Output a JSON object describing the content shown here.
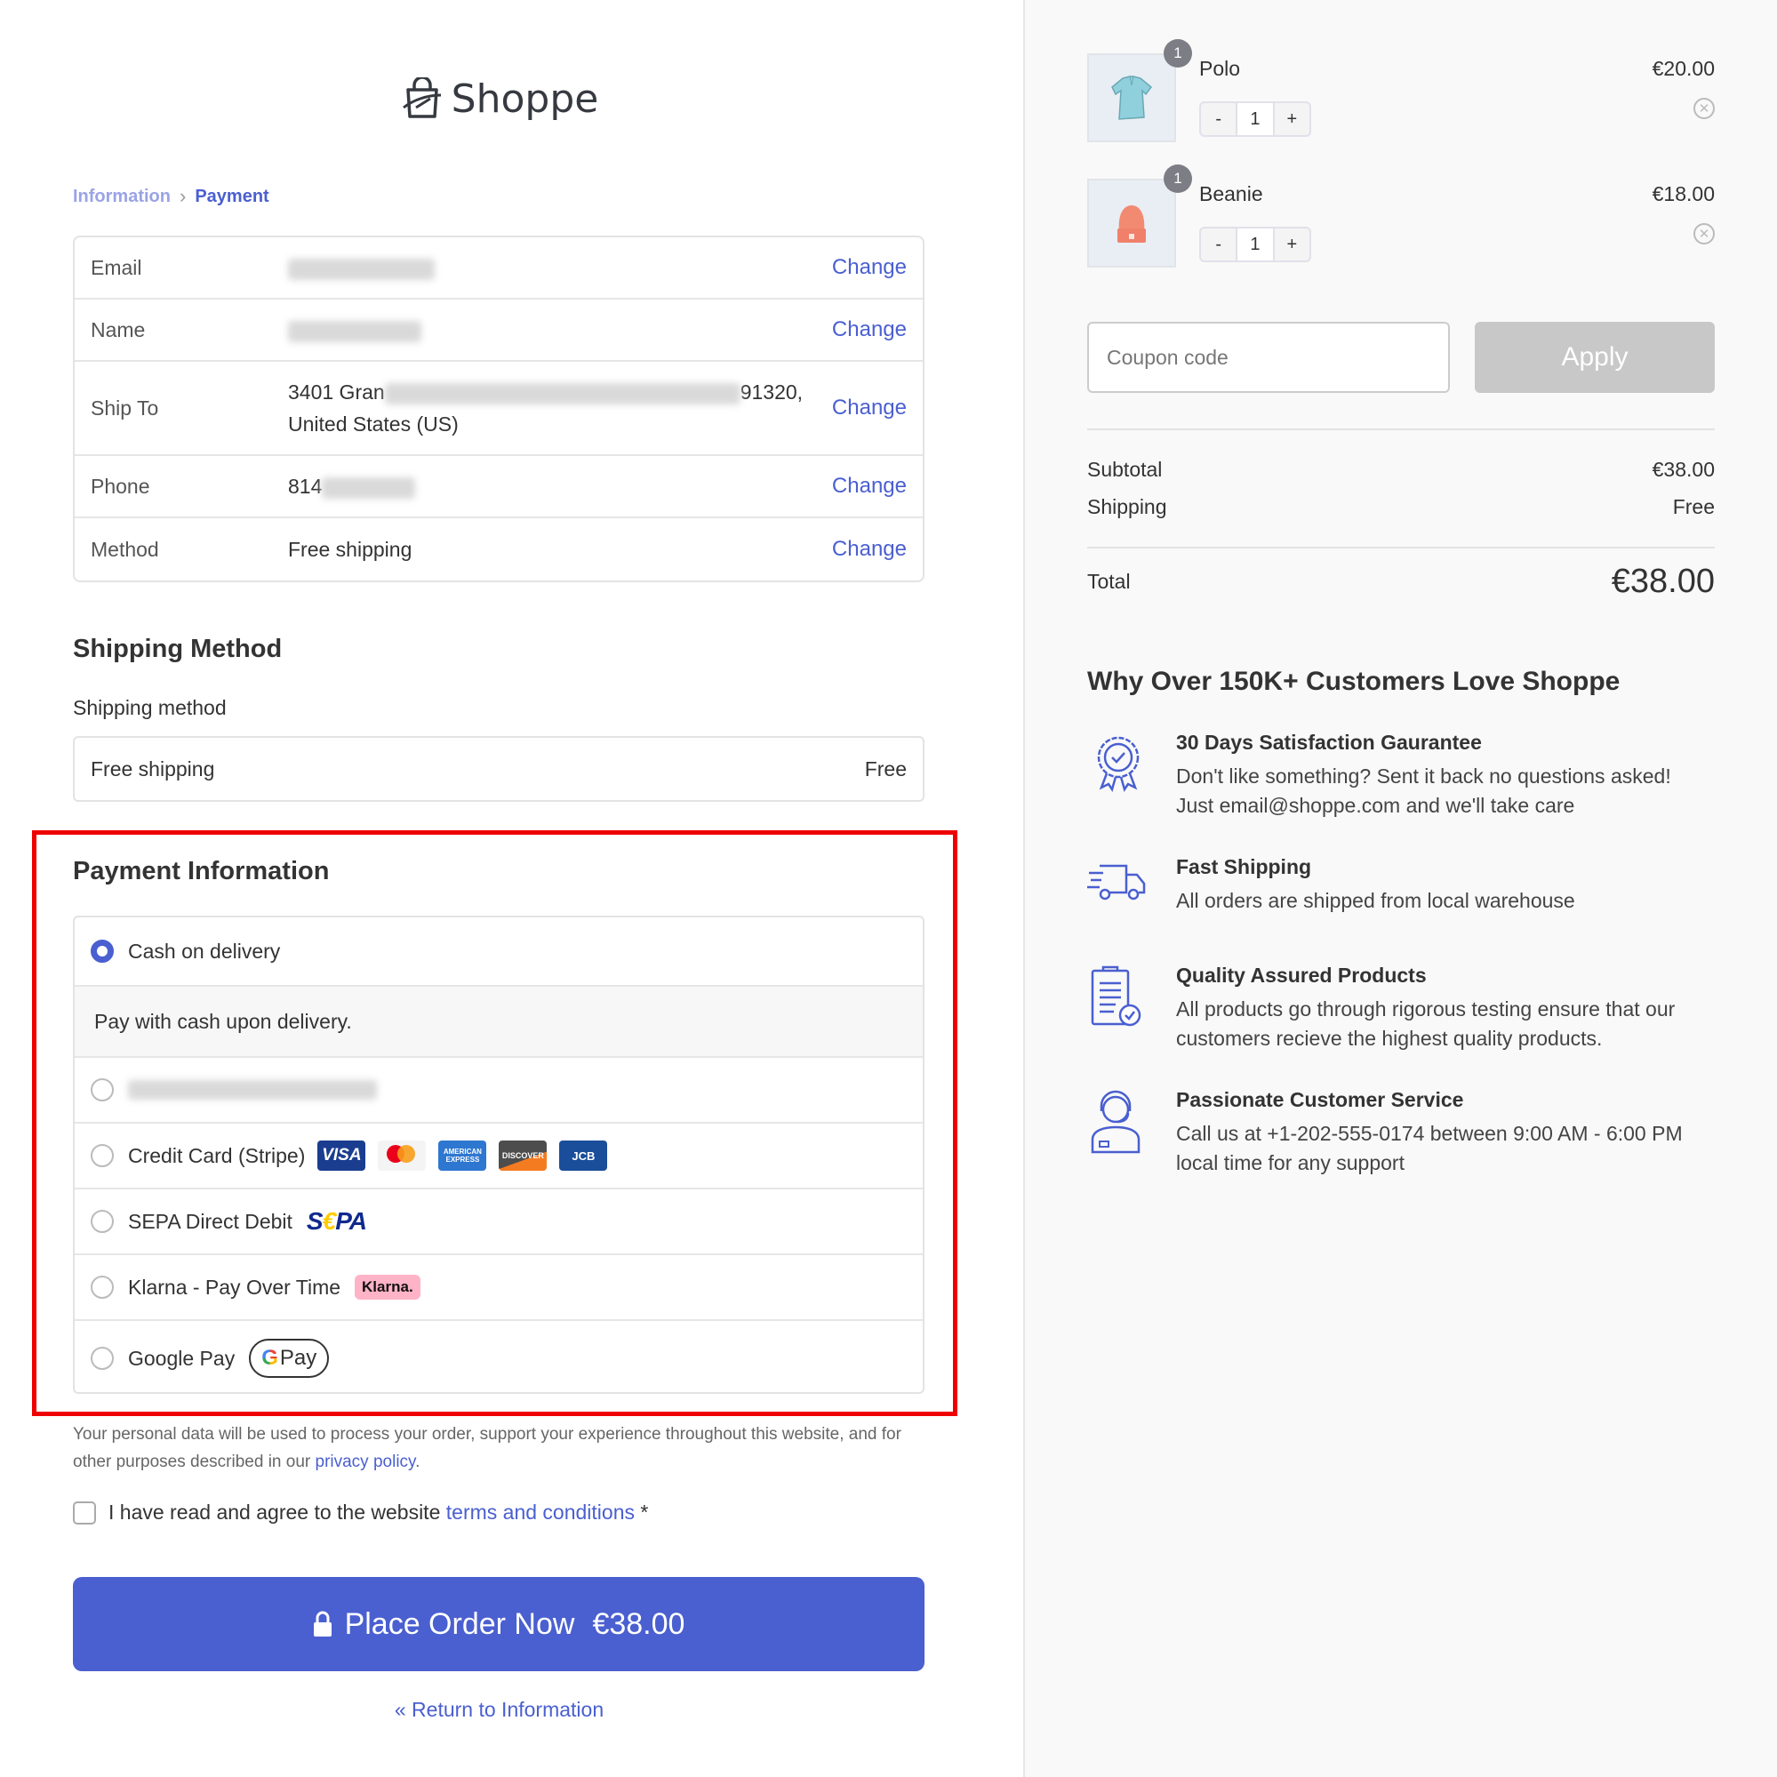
{
  "brand": {
    "name": "Shoppe"
  },
  "breadcrumb": {
    "items": [
      "Information",
      "Payment"
    ]
  },
  "info_table": {
    "change_label": "Change",
    "rows": [
      {
        "label": "Email",
        "value": ""
      },
      {
        "label": "Name",
        "value": ""
      },
      {
        "label": "Ship To",
        "value_line1_start": "3401 Gran",
        "value_line1_end": "91320,",
        "value_line2": "United States (US)"
      },
      {
        "label": "Phone",
        "value": "814"
      },
      {
        "label": "Method",
        "value": "Free shipping"
      }
    ]
  },
  "shipping_method": {
    "heading": "Shipping Method",
    "label": "Shipping method",
    "option_name": "Free shipping",
    "option_price": "Free"
  },
  "payment": {
    "heading": "Payment Information",
    "options": [
      {
        "label": "Cash on delivery",
        "selected": true,
        "description": "Pay with cash upon delivery."
      },
      {
        "label": "",
        "selected": false
      },
      {
        "label": "Credit Card (Stripe)",
        "selected": false,
        "cards": [
          "VISA",
          "mastercard",
          "AMERICAN EXPRESS",
          "DISCOVER",
          "JCB"
        ]
      },
      {
        "label": "SEPA Direct Debit",
        "selected": false,
        "badge": "SEPA"
      },
      {
        "label": "Klarna - Pay Over Time",
        "selected": false,
        "badge": "Klarna."
      },
      {
        "label": "Google Pay",
        "selected": false,
        "badge": "Pay"
      }
    ]
  },
  "privacy": {
    "text": "Your personal data will be used to process your order, support your experience throughout this website, and for other purposes described in our ",
    "link": "privacy policy",
    "end": "."
  },
  "terms": {
    "text": "I have read and agree to the website ",
    "link": "terms and conditions",
    "required": " *",
    "checked": false
  },
  "place_order": {
    "label": "Place Order Now",
    "amount": "€38.00"
  },
  "return_link": "« Return to Information",
  "cart": {
    "items": [
      {
        "name": "Polo",
        "price": "€20.00",
        "quantity": "1",
        "badge": "1"
      },
      {
        "name": "Beanie",
        "price": "€18.00",
        "quantity": "1",
        "badge": "1"
      }
    ],
    "minus": "-",
    "plus": "+"
  },
  "coupon": {
    "placeholder": "Coupon code",
    "apply_label": "Apply"
  },
  "summary": {
    "subtotal_label": "Subtotal",
    "subtotal": "€38.00",
    "shipping_label": "Shipping",
    "shipping": "Free",
    "total_label": "Total",
    "total": "€38.00"
  },
  "why": {
    "heading": "Why Over 150K+ Customers Love Shoppe",
    "features": [
      {
        "icon": "badge-check-icon",
        "title": "30 Days Satisfaction Gaurantee",
        "desc": "Don't like something? Sent it back no questions asked! Just email@shoppe.com and we'll take care"
      },
      {
        "icon": "truck-icon",
        "title": "Fast Shipping",
        "desc": "All orders are shipped from local warehouse"
      },
      {
        "icon": "clipboard-check-icon",
        "title": "Quality Assured Products",
        "desc": "All products go through rigorous testing ensure that our customers recieve the highest quality products."
      },
      {
        "icon": "support-agent-icon",
        "title": "Passionate Customer Service",
        "desc": "Call us at +1-202-555-0174 between 9:00 AM - 6:00 PM local time for any support"
      }
    ]
  },
  "colors": {
    "accent": "#4a5fd0",
    "highlight_box": "#ee0000",
    "apply_disabled": "#c8c8c8"
  }
}
